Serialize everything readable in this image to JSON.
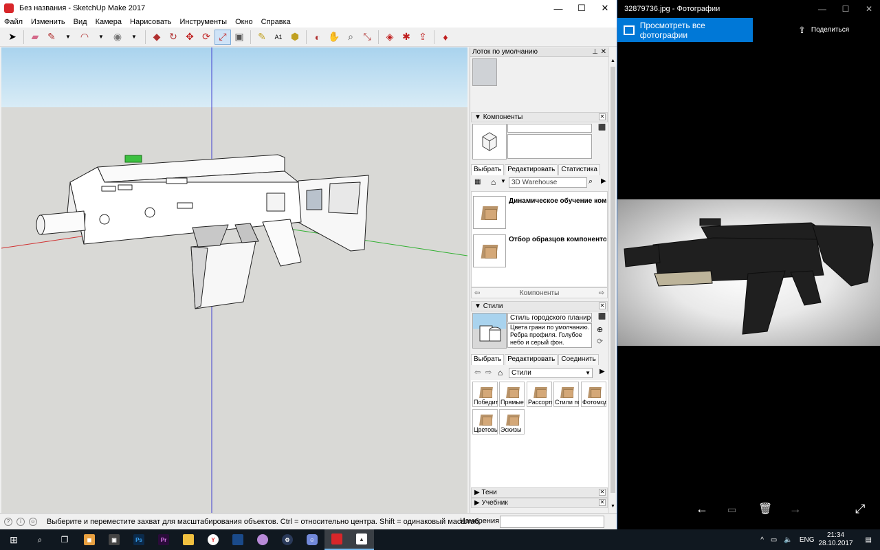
{
  "sketchup": {
    "title": "Без названия - SketchUp Make 2017",
    "menu": [
      "Файл",
      "Изменить",
      "Вид",
      "Камера",
      "Нарисовать",
      "Инструменты",
      "Окно",
      "Справка"
    ],
    "tray_title": "Лоток по умолчанию",
    "components": {
      "header": "Компоненты",
      "tabs": [
        "Выбрать",
        "Редактировать",
        "Статистика"
      ],
      "search_placeholder": "3D Warehouse",
      "items": [
        "Динамическое обучение ком...",
        "Отбор образцов компонентов"
      ],
      "footer": "Компоненты"
    },
    "styles": {
      "header": "Стили",
      "style_name": "Стиль городского планирован",
      "style_desc": "Цвета грани по умолчанию. Ребра профиля. Голубое небо и серый фон.",
      "tabs": [
        "Выбрать",
        "Редактировать",
        "Соединить"
      ],
      "dropdown_value": "Стили",
      "grid": [
        "Победит",
        "Прямые",
        "Рассорти",
        "Стили по",
        "Фотомод",
        "Цветовь",
        "Эскизы"
      ]
    },
    "collapsed_sections": [
      "Тени",
      "Учебник"
    ],
    "status": {
      "hint": "Выберите и переместите захват для масштабирования объектов. Ctrl = относительно центра. Shift = одинаковый масштаб.",
      "measure_label": "Измерения",
      "measure_value": ""
    }
  },
  "photos": {
    "title": "32879736.jpg - Фотографии",
    "view_all": "Просмотреть все фотографии",
    "share": "Поделиться"
  },
  "taskbar": {
    "lang": "ENG",
    "time": "21:34",
    "date": "28.10.2017",
    "apps": [
      "start-icon",
      "search-icon",
      "task-view-icon",
      "store-icon",
      "explorer-icon",
      "photoshop-icon",
      "premiere-icon",
      "folder-icon",
      "yandex-icon",
      "monitor-icon",
      "app-icon",
      "steam-icon",
      "discord-icon",
      "sketchup-icon",
      "photos-icon"
    ]
  },
  "colors": {
    "accent": "#0078d7",
    "sky": "#b9dbf0",
    "ground": "#d9d9d6",
    "taskbar": "#101820"
  }
}
